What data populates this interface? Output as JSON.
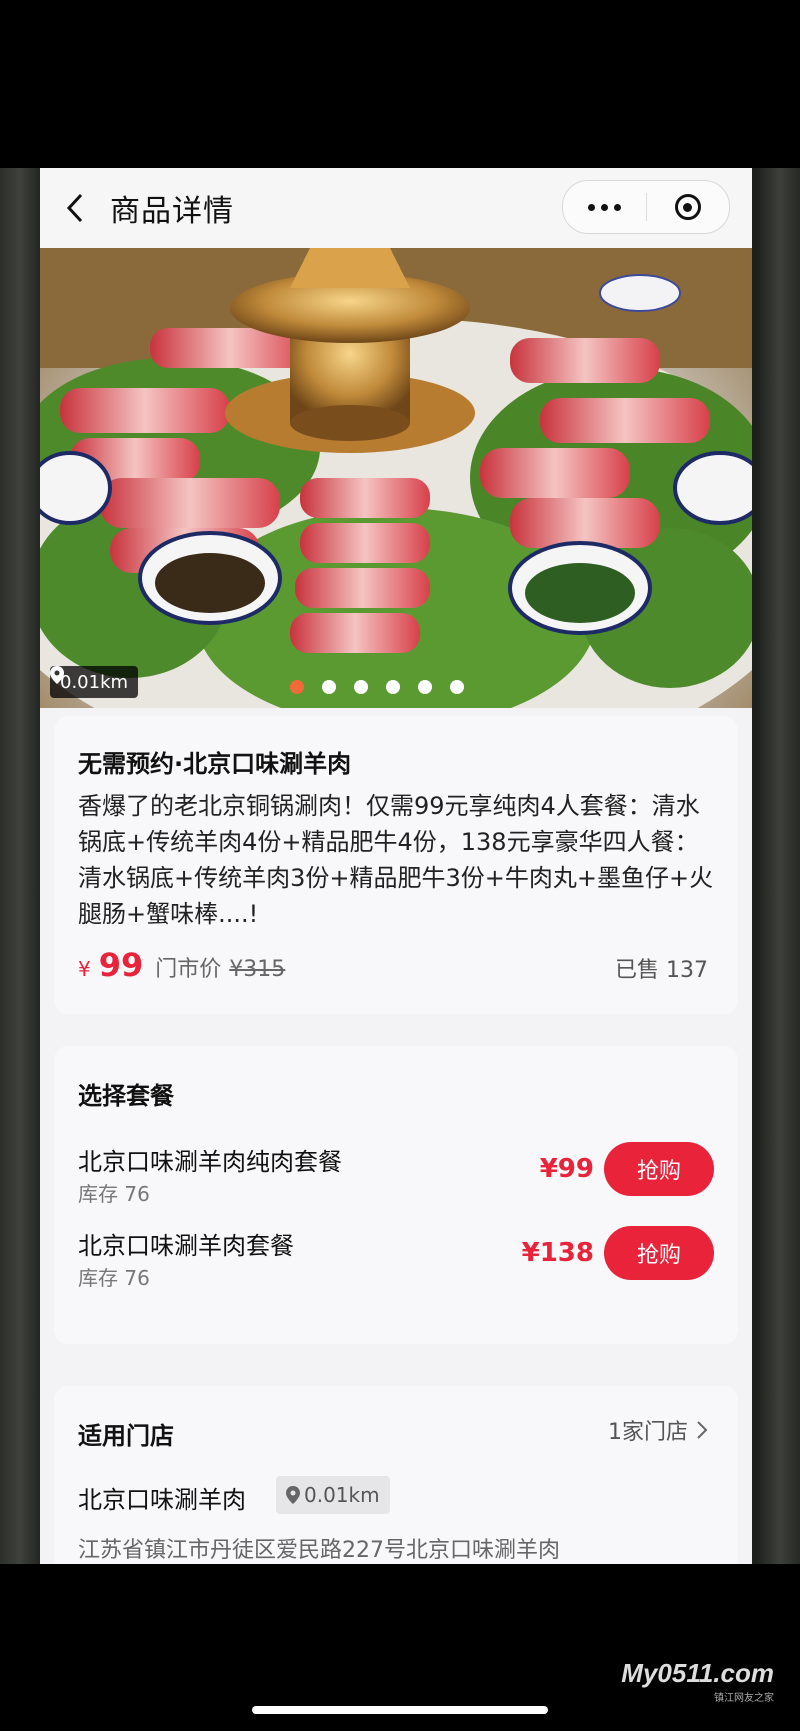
{
  "navbar": {
    "title": "商品详情"
  },
  "hero": {
    "distance": "0.01km",
    "pager_count": 6,
    "pager_active": 0
  },
  "product": {
    "title": "无需预约·北京口味涮羊肉",
    "description": "香爆了的老北京铜锅涮肉！仅需99元享纯肉4人套餐：清水锅底+传统羊肉4份+精品肥牛4份，138元享豪华四人餐：清水锅底+传统羊肉3份+精品肥牛3份+牛肉丸+墨鱼仔+火腿肠+蟹味棒....!",
    "currency": "¥",
    "price": "99",
    "original_label": "门市价",
    "original_price": "¥315",
    "sold": "已售 137"
  },
  "packages": {
    "title": "选择套餐",
    "items": [
      {
        "name": "北京口味涮羊肉纯肉套餐",
        "stock": "库存 76",
        "price": "¥99",
        "button": "抢购"
      },
      {
        "name": "北京口味涮羊肉套餐",
        "stock": "库存 76",
        "price": "¥138",
        "button": "抢购"
      }
    ]
  },
  "stores": {
    "title": "适用门店",
    "count": "1家门店",
    "name": "北京口味涮羊肉",
    "distance": "0.01km",
    "address": "江苏省镇江市丹徒区爱民路227号北京口味涮羊肉"
  },
  "watermark": {
    "logo": "My0511.com",
    "sub": "镇江网友之家"
  },
  "colors": {
    "accent": "#e8233a",
    "pager_active": "#f26a3a"
  }
}
